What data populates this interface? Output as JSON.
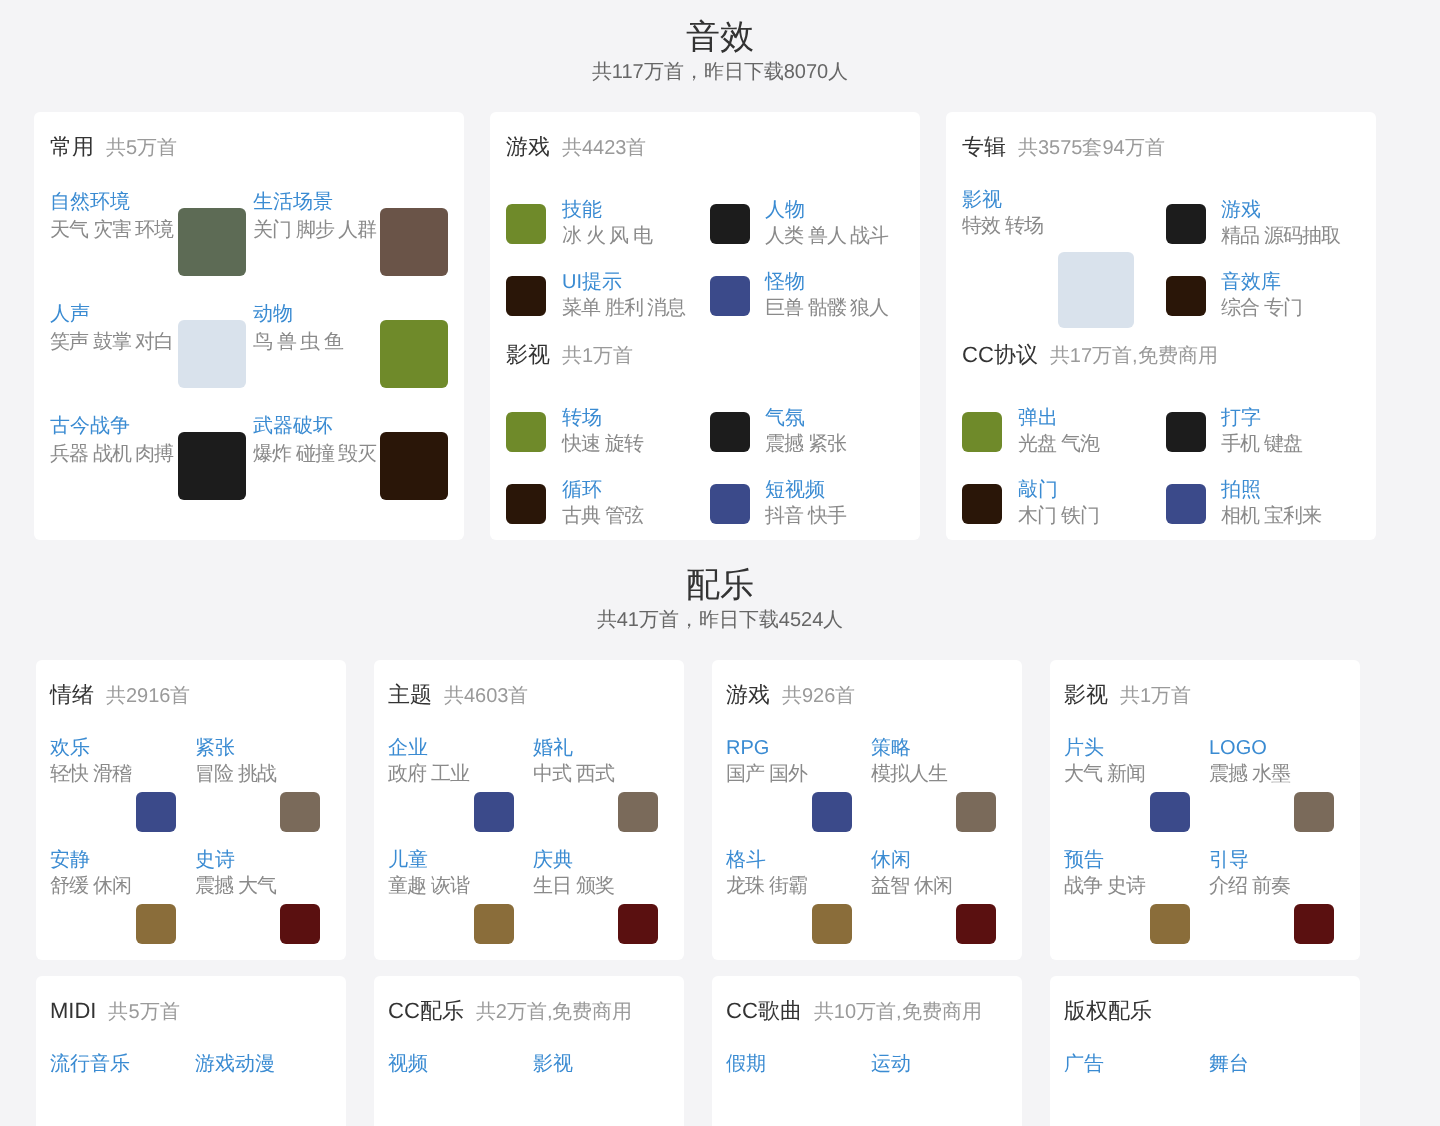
{
  "groups": [
    {
      "title": "音效",
      "subtitle": "共117万首，昨日下载8070人",
      "cards": [
        {
          "sections": [
            {
              "title": "常用",
              "count": "共5万首",
              "items": [
                {
                  "kind": "thumb",
                  "title": "自然环境",
                  "tags": "天气 灾害 环境"
                },
                {
                  "kind": "thumb",
                  "title": "生活场景",
                  "tags": "关门 脚步 人群"
                },
                {
                  "kind": "thumb",
                  "title": "人声",
                  "tags": "笑声 鼓掌 对白"
                },
                {
                  "kind": "thumb",
                  "title": "动物",
                  "tags": "鸟 兽 虫 鱼"
                },
                {
                  "kind": "thumb",
                  "title": "古今战争",
                  "tags": "兵器 战机 肉搏"
                },
                {
                  "kind": "thumb",
                  "title": "武器破坏",
                  "tags": "爆炸 碰撞 毁灭"
                }
              ]
            }
          ]
        },
        {
          "sections": [
            {
              "title": "游戏",
              "count": "共4423首",
              "items": [
                {
                  "kind": "icon",
                  "title": "技能",
                  "tags": "冰 火 风 电"
                },
                {
                  "kind": "icon",
                  "title": "人物",
                  "tags": "人类 兽人 战斗"
                },
                {
                  "kind": "icon",
                  "title": "UI提示",
                  "tags": "菜单 胜利 消息"
                },
                {
                  "kind": "icon",
                  "title": "怪物",
                  "tags": "巨兽 骷髅 狼人"
                }
              ]
            },
            {
              "title": "影视",
              "count": "共1万首",
              "items": [
                {
                  "kind": "icon",
                  "title": "转场",
                  "tags": "快速 旋转"
                },
                {
                  "kind": "icon",
                  "title": "气氛",
                  "tags": "震撼 紧张"
                },
                {
                  "kind": "icon",
                  "title": "循环",
                  "tags": "古典 管弦"
                },
                {
                  "kind": "icon",
                  "title": "短视频",
                  "tags": "抖音 快手"
                }
              ]
            }
          ]
        },
        {
          "sections": [
            {
              "title": "专辑",
              "count": "共3575套94万首",
              "items": [
                {
                  "kind": "featured",
                  "title": "影视",
                  "tags": "特效 转场"
                },
                {
                  "kind": "icon",
                  "title": "游戏",
                  "tags": "精品 源码抽取"
                },
                {
                  "kind": "icon",
                  "title": "音效库",
                  "tags": "综合 专门"
                }
              ]
            },
            {
              "title": "CC协议",
              "count": "共17万首,免费商用",
              "items": [
                {
                  "kind": "icon",
                  "title": "弹出",
                  "tags": "光盘 气泡"
                },
                {
                  "kind": "icon",
                  "title": "打字",
                  "tags": "手机 键盘"
                },
                {
                  "kind": "icon",
                  "title": "敲门",
                  "tags": "木门 铁门"
                },
                {
                  "kind": "icon",
                  "title": "拍照",
                  "tags": "相机 宝利来"
                }
              ]
            }
          ]
        }
      ]
    },
    {
      "title": "配乐",
      "subtitle": "共41万首，昨日下载4524人",
      "cards": [
        {
          "sections": [
            {
              "title": "情绪",
              "count": "共2916首",
              "items": [
                {
                  "kind": "music",
                  "title": "欢乐",
                  "tags": "轻快 滑稽"
                },
                {
                  "kind": "music",
                  "title": "紧张",
                  "tags": "冒险 挑战"
                },
                {
                  "kind": "music",
                  "title": "安静",
                  "tags": "舒缓 休闲"
                },
                {
                  "kind": "music",
                  "title": "史诗",
                  "tags": "震撼 大气"
                }
              ]
            }
          ]
        },
        {
          "sections": [
            {
              "title": "主题",
              "count": "共4603首",
              "items": [
                {
                  "kind": "music",
                  "title": "企业",
                  "tags": "政府 工业"
                },
                {
                  "kind": "music",
                  "title": "婚礼",
                  "tags": "中式 西式"
                },
                {
                  "kind": "music",
                  "title": "儿童",
                  "tags": "童趣 诙谐"
                },
                {
                  "kind": "music",
                  "title": "庆典",
                  "tags": "生日 颁奖"
                }
              ]
            }
          ]
        },
        {
          "sections": [
            {
              "title": "游戏",
              "count": "共926首",
              "items": [
                {
                  "kind": "music",
                  "title": "RPG",
                  "tags": "国产 国外"
                },
                {
                  "kind": "music",
                  "title": "策略",
                  "tags": "模拟人生"
                },
                {
                  "kind": "music",
                  "title": "格斗",
                  "tags": "龙珠 街霸"
                },
                {
                  "kind": "music",
                  "title": "休闲",
                  "tags": "益智 休闲"
                }
              ]
            }
          ]
        },
        {
          "sections": [
            {
              "title": "影视",
              "count": "共1万首",
              "items": [
                {
                  "kind": "music",
                  "title": "片头",
                  "tags": "大气 新闻"
                },
                {
                  "kind": "music",
                  "title": "LOGO",
                  "tags": "震撼 水墨"
                },
                {
                  "kind": "music",
                  "title": "预告",
                  "tags": "战争 史诗"
                },
                {
                  "kind": "music",
                  "title": "引导",
                  "tags": "介绍 前奏"
                }
              ]
            }
          ]
        },
        {
          "sections": [
            {
              "title": "MIDI",
              "count": "共5万首",
              "items": [
                {
                  "kind": "partial",
                  "title": "流行音乐"
                },
                {
                  "kind": "partial",
                  "title": "游戏动漫"
                }
              ]
            }
          ]
        },
        {
          "sections": [
            {
              "title": "CC配乐",
              "count": "共2万首,免费商用",
              "items": [
                {
                  "kind": "partial",
                  "title": "视频"
                },
                {
                  "kind": "partial",
                  "title": "影视"
                }
              ]
            }
          ]
        },
        {
          "sections": [
            {
              "title": "CC歌曲",
              "count": "共10万首,免费商用",
              "items": [
                {
                  "kind": "partial",
                  "title": "假期"
                },
                {
                  "kind": "partial",
                  "title": "运动"
                }
              ]
            }
          ]
        },
        {
          "sections": [
            {
              "title": "版权配乐",
              "items": [
                {
                  "kind": "partial",
                  "title": "广告"
                },
                {
                  "kind": "partial",
                  "title": "舞台"
                }
              ]
            }
          ]
        }
      ]
    }
  ]
}
